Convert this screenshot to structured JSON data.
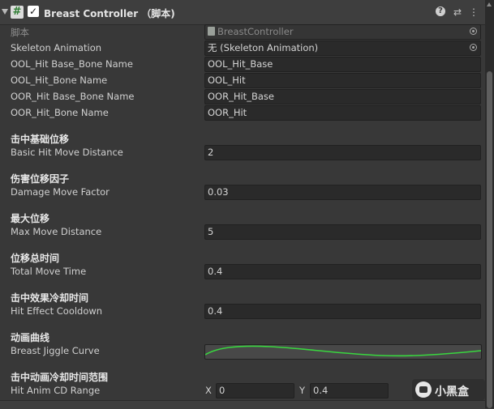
{
  "header": {
    "title": "Breast Controller （脚本)",
    "help_icon": "help-icon",
    "settings_icon": "sliders-icon",
    "menu_icon": "kebab-menu-icon"
  },
  "script_row": {
    "label": "脚本",
    "value": "BreastController"
  },
  "skeleton_row": {
    "label": "Skeleton Animation",
    "value": "无 (Skeleton Animation)"
  },
  "bones": [
    {
      "label": "OOL_Hit Base_Bone Name",
      "value": "OOL_Hit_Base"
    },
    {
      "label": "OOL_Hit_Bone Name",
      "value": "OOL_Hit"
    },
    {
      "label": "OOR_Hit Base_Bone Name",
      "value": "OOR_Hit_Base"
    },
    {
      "label": "OOR_Hit_Bone Name",
      "value": "OOR_Hit"
    }
  ],
  "sections": [
    {
      "title": "击中基础位移",
      "label": "Basic Hit Move Distance",
      "value": "2"
    },
    {
      "title": "伤害位移因子",
      "label": "Damage Move Factor",
      "value": "0.03"
    },
    {
      "title": "最大位移",
      "label": "Max Move Distance",
      "value": "5"
    },
    {
      "title": "位移总时间",
      "label": "Total Move Time",
      "value": "0.4"
    },
    {
      "title": "击中效果冷却时间",
      "label": "Hit Effect Cooldown",
      "value": "0.4"
    }
  ],
  "curve_section": {
    "title": "动画曲线",
    "label": "Breast Jiggle Curve",
    "curve_color": "#39d63f"
  },
  "range_section": {
    "title": "击中动画冷却时间范围",
    "label": "Hit Anim CD Range",
    "x_label": "X",
    "x_value": "0",
    "y_label": "Y",
    "y_value": "0.4"
  },
  "watermark": {
    "text": "小黑盒"
  }
}
